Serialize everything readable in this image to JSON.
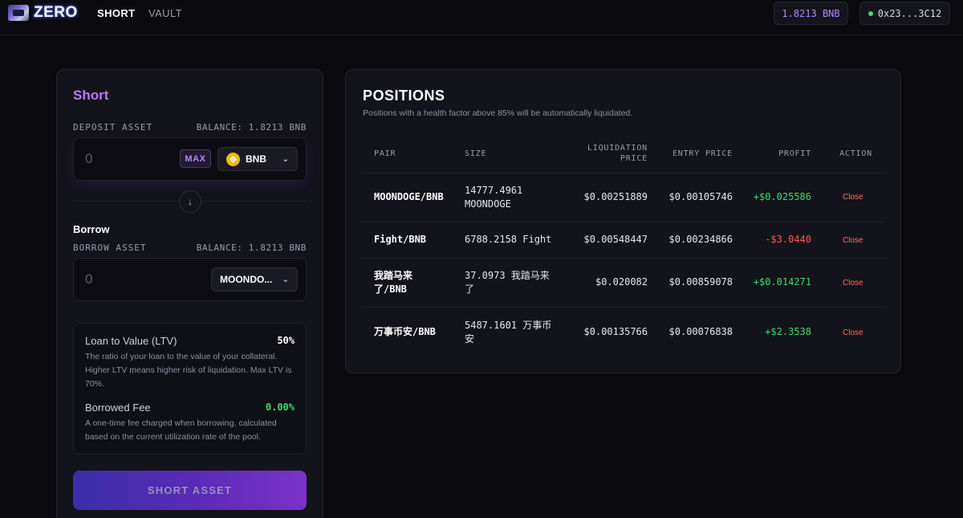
{
  "nav": {
    "logo_text": "ZERO",
    "links": [
      {
        "label": "SHORT",
        "active": true
      },
      {
        "label": "VAULT",
        "active": false
      }
    ],
    "balance": "1.8213 BNB",
    "wallet": "0x23...3C12"
  },
  "short_panel": {
    "title": "Short",
    "deposit": {
      "label": "DEPOSIT ASSET",
      "balance": "BALANCE: 1.8213 BNB",
      "amount_placeholder": "0",
      "max_label": "MAX",
      "token": "BNB"
    },
    "borrow": {
      "title": "Borrow",
      "label": "BORROW ASSET",
      "balance": "BALANCE: 1.8213 BNB",
      "amount_placeholder": "0",
      "token": "MOONDO..."
    },
    "ltv": {
      "label": "Loan to Value (LTV)",
      "value": "50%",
      "desc": "The ratio of your loan to the value of your collateral. Higher LTV means higher risk of liquidation. Max LTV is 70%."
    },
    "fee": {
      "label": "Borrowed Fee",
      "value": "0.00%",
      "desc": "A one-time fee charged when borrowing, calculated based on the current utilization rate of the pool."
    },
    "submit_label": "SHORT ASSET"
  },
  "positions": {
    "title": "POSITIONS",
    "subtitle": "Positions with a health factor above 85% will be automatically liquidated.",
    "headers": {
      "pair": "PAIR",
      "size": "SIZE",
      "liq_line1": "LIQUIDATION",
      "liq_line2": "PRICE",
      "entry": "ENTRY PRICE",
      "profit": "PROFIT",
      "action": "ACTION"
    },
    "rows": [
      {
        "pair": "MOONDOGE/BNB",
        "size": "14777.4961 MOONDOGE",
        "liq": "$0.00251889",
        "entry": "$0.00105746",
        "profit": "+$0.025586",
        "action": "Close"
      },
      {
        "pair": "Fight/BNB",
        "size": "6788.2158 Fight",
        "liq": "$0.00548447",
        "entry": "$0.00234866",
        "profit": "-$3.0440",
        "action": "Close"
      },
      {
        "pair": "我踏马来了/BNB",
        "size": "37.0973 我踏马来了",
        "liq": "$0.020082",
        "entry": "$0.00859078",
        "profit": "+$0.014271",
        "action": "Close"
      },
      {
        "pair": "万事币安/BNB",
        "size": "5487.1601 万事币安",
        "liq": "$0.00135766",
        "entry": "$0.00076838",
        "profit": "+$2.3538",
        "action": "Close"
      }
    ]
  },
  "colors": {
    "accent": "#b87cf7",
    "positive": "#3ddc6b",
    "negative": "#ff5a5a",
    "background": "#0a0a0f",
    "panel": "#13131b"
  }
}
